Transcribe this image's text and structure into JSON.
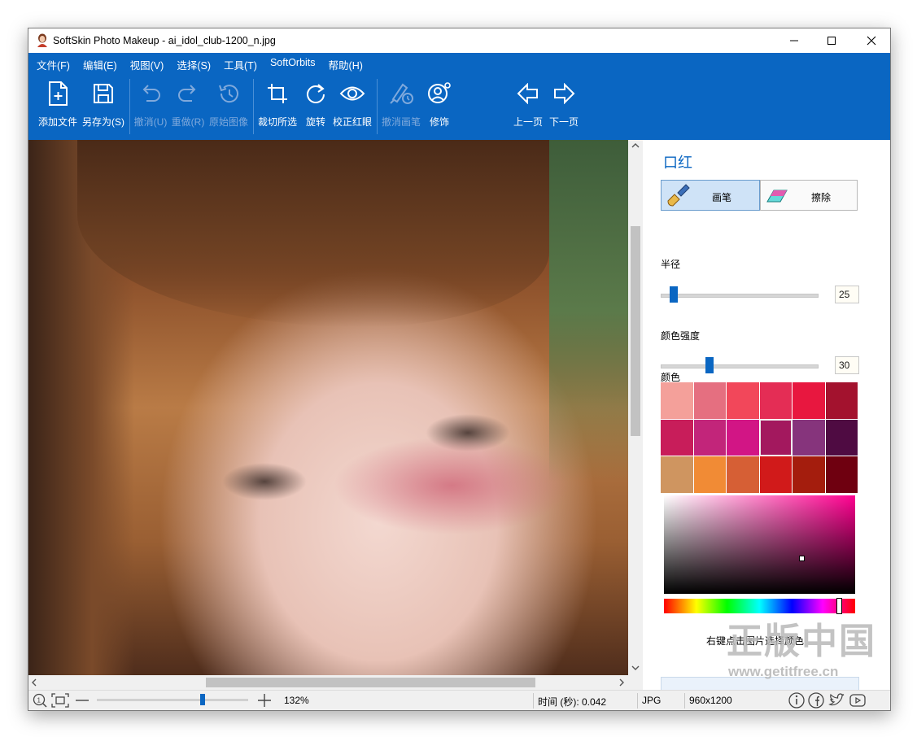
{
  "window": {
    "title": "SoftSkin Photo Makeup - ai_idol_club-1200_n.jpg",
    "controls": [
      "minimize",
      "maximize",
      "close"
    ]
  },
  "menu": [
    "文件(F)",
    "编辑(E)",
    "视图(V)",
    "选择(S)",
    "工具(T)",
    "SoftOrbits",
    "帮助(H)"
  ],
  "toolbar": {
    "add_file": "添加文件",
    "save_as": "另存为(S)",
    "undo": "撤消(U)",
    "redo": "重做(R)",
    "original": "原始图像",
    "crop": "裁切所选",
    "rotate": "旋转",
    "redeye": "校正红眼",
    "undo_brush": "撤消画笔",
    "retouch": "修饰",
    "prev": "上一页",
    "next": "下一页"
  },
  "panel": {
    "title": "口红",
    "brush_label": "画笔",
    "erase_label": "擦除",
    "radius_label": "半径",
    "radius_value": "25",
    "intensity_label": "颜色强度",
    "intensity_value": "30",
    "color_label": "颜色",
    "swatches": [
      "#f4a09a",
      "#e56f80",
      "#f2475a",
      "#e42d55",
      "#e8173f",
      "#a3122e",
      "#c81d5a",
      "#c2257a",
      "#d21585",
      "#a3185e",
      "#86347c",
      "#4f0b42",
      "#cf9560",
      "#f18b35",
      "#d65f35",
      "#d11a1a",
      "#a41d0d",
      "#6f0010"
    ],
    "selected_swatch_index": 9,
    "hint": "右键点击图片选择颜色"
  },
  "status": {
    "zoom": "132%",
    "time": "时间 (秒): 0.042",
    "format": "JPG",
    "dimensions": "960x1200",
    "zoom_slider_fraction": 0.7
  },
  "watermark": {
    "big": "正版中国",
    "small": "www.getitfree.cn"
  },
  "colors": {
    "accent": "#0a66c2",
    "ribbon": "#0a66c2"
  }
}
